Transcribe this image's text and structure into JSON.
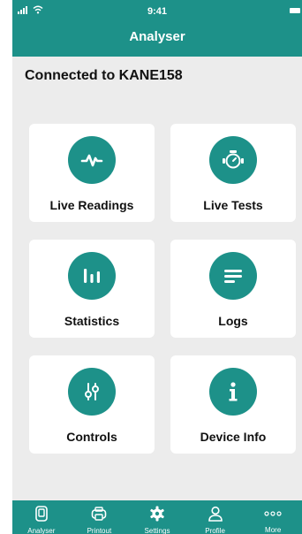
{
  "status_bar": {
    "time": "9:41"
  },
  "header": {
    "title": "Analyser"
  },
  "connection": {
    "text": "Connected to KANE158"
  },
  "tiles": [
    {
      "label": "Live Readings",
      "icon": "pulse-icon"
    },
    {
      "label": "Live Tests",
      "icon": "gauge-icon"
    },
    {
      "label": "Statistics",
      "icon": "bar-chart-icon"
    },
    {
      "label": "Logs",
      "icon": "list-icon"
    },
    {
      "label": "Controls",
      "icon": "sliders-icon"
    },
    {
      "label": "Device Info",
      "icon": "info-icon"
    }
  ],
  "nav": [
    {
      "label": "Analyser",
      "icon": "analyser-icon"
    },
    {
      "label": "Printout",
      "icon": "printer-icon"
    },
    {
      "label": "Settings",
      "icon": "gear-icon"
    },
    {
      "label": "Profile",
      "icon": "user-icon"
    },
    {
      "label": "More",
      "icon": "more-icon"
    }
  ],
  "colors": {
    "primary": "#1d9189",
    "background": "#ececec",
    "tile": "#ffffff"
  }
}
